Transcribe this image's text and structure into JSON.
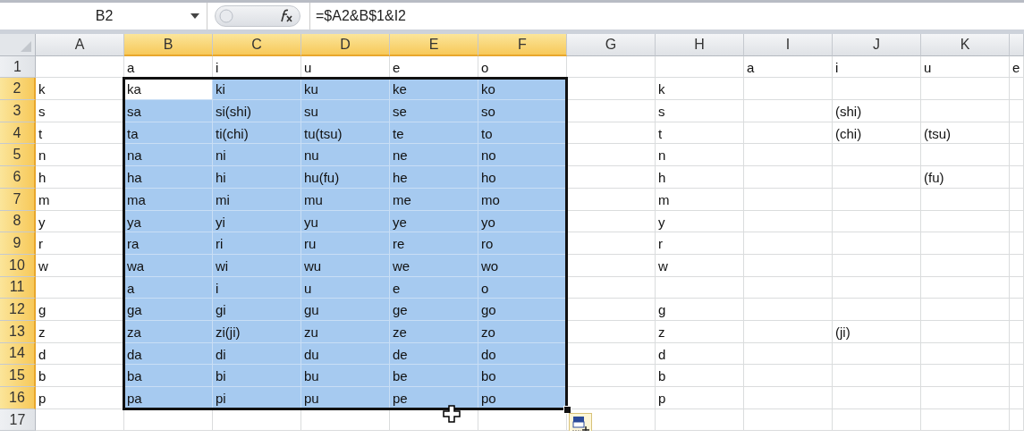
{
  "formula_bar": {
    "name_box": "B2",
    "formula": "=$A2&B$1&I2"
  },
  "columns": [
    {
      "label": "A",
      "selected": false
    },
    {
      "label": "B",
      "selected": true
    },
    {
      "label": "C",
      "selected": true
    },
    {
      "label": "D",
      "selected": true
    },
    {
      "label": "E",
      "selected": true
    },
    {
      "label": "F",
      "selected": true
    },
    {
      "label": "G",
      "selected": false
    },
    {
      "label": "H",
      "selected": false
    },
    {
      "label": "I",
      "selected": false
    },
    {
      "label": "J",
      "selected": false
    },
    {
      "label": "K",
      "selected": false
    },
    {
      "selected": false
    }
  ],
  "rows": [
    {
      "number": "1",
      "selected": false,
      "cells": [
        null,
        "a",
        "i",
        "u",
        "e",
        "o",
        null,
        null,
        "a",
        "i",
        "u",
        "e"
      ]
    },
    {
      "number": "2",
      "selected": true,
      "cells": [
        "k",
        {
          "text": "ka",
          "active": true
        },
        "ki",
        "ku",
        "ke",
        "ko",
        null,
        "k",
        null,
        null,
        null,
        null
      ]
    },
    {
      "number": "3",
      "selected": true,
      "cells": [
        "s",
        "sa",
        "si(shi)",
        "su",
        "se",
        "so",
        null,
        "s",
        null,
        "(shi)",
        null,
        null
      ]
    },
    {
      "number": "4",
      "selected": true,
      "cells": [
        "t",
        "ta",
        "ti(chi)",
        "tu(tsu)",
        "te",
        "to",
        null,
        "t",
        null,
        "(chi)",
        "(tsu)",
        null
      ]
    },
    {
      "number": "5",
      "selected": true,
      "cells": [
        "n",
        "na",
        "ni",
        "nu",
        "ne",
        "no",
        null,
        "n",
        null,
        null,
        null,
        null
      ]
    },
    {
      "number": "6",
      "selected": true,
      "cells": [
        "h",
        "ha",
        "hi",
        "hu(fu)",
        "he",
        "ho",
        null,
        "h",
        null,
        null,
        "(fu)",
        null
      ]
    },
    {
      "number": "7",
      "selected": true,
      "cells": [
        "m",
        "ma",
        "mi",
        "mu",
        "me",
        "mo",
        null,
        "m",
        null,
        null,
        null,
        null
      ]
    },
    {
      "number": "8",
      "selected": true,
      "cells": [
        "y",
        "ya",
        "yi",
        "yu",
        "ye",
        "yo",
        null,
        "y",
        null,
        null,
        null,
        null
      ]
    },
    {
      "number": "9",
      "selected": true,
      "cells": [
        "r",
        "ra",
        "ri",
        "ru",
        "re",
        "ro",
        null,
        "r",
        null,
        null,
        null,
        null
      ]
    },
    {
      "number": "10",
      "selected": true,
      "cells": [
        "w",
        "wa",
        "wi",
        "wu",
        "we",
        "wo",
        null,
        "w",
        null,
        null,
        null,
        null
      ]
    },
    {
      "number": "11",
      "selected": true,
      "cells": [
        null,
        "a",
        "i",
        "u",
        "e",
        "o",
        null,
        null,
        null,
        null,
        null,
        null
      ]
    },
    {
      "number": "12",
      "selected": true,
      "cells": [
        "g",
        "ga",
        "gi",
        "gu",
        "ge",
        "go",
        null,
        "g",
        null,
        null,
        null,
        null
      ]
    },
    {
      "number": "13",
      "selected": true,
      "cells": [
        "z",
        "za",
        "zi(ji)",
        "zu",
        "ze",
        "zo",
        null,
        "z",
        null,
        "(ji)",
        null,
        null
      ]
    },
    {
      "number": "14",
      "selected": true,
      "cells": [
        "d",
        "da",
        "di",
        "du",
        "de",
        "do",
        null,
        "d",
        null,
        null,
        null,
        null
      ]
    },
    {
      "number": "15",
      "selected": true,
      "cells": [
        "b",
        "ba",
        "bi",
        "bu",
        "be",
        "bo",
        null,
        "b",
        null,
        null,
        null,
        null
      ]
    },
    {
      "number": "16",
      "selected": true,
      "cells": [
        "p",
        "pa",
        "pi",
        "pu",
        "pe",
        "po",
        null,
        "p",
        null,
        null,
        null,
        null
      ]
    },
    {
      "number": "17",
      "selected": false,
      "cells": [
        null,
        null,
        null,
        null,
        null,
        null,
        null,
        null,
        null,
        null,
        null,
        null
      ]
    }
  ]
}
